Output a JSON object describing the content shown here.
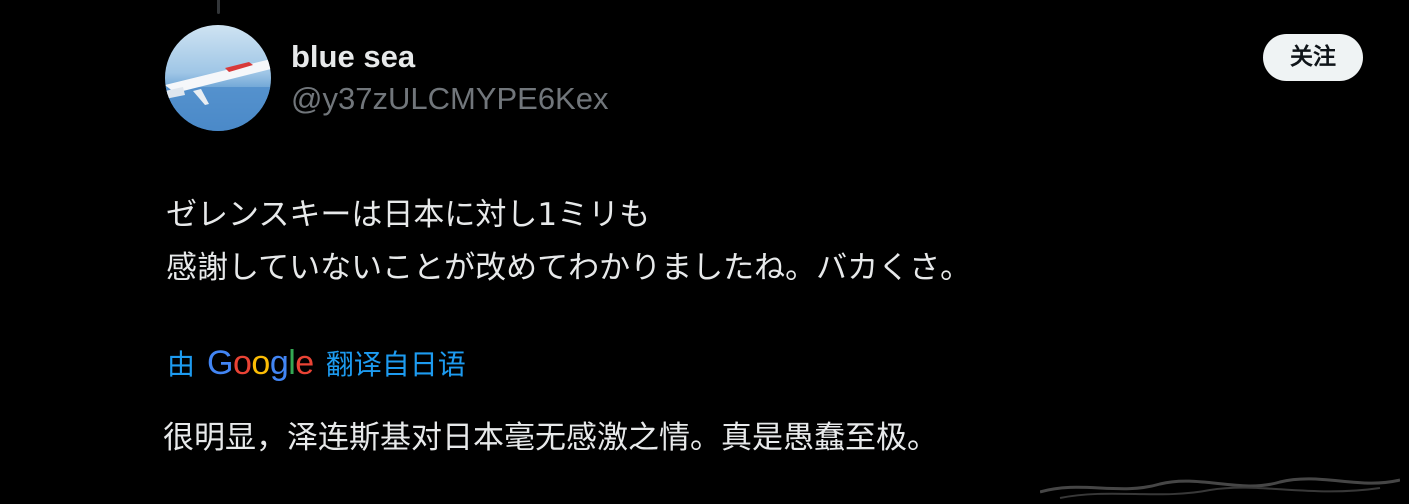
{
  "author": {
    "display_name": "blue sea",
    "handle": "@y37zULCMYPE6Kex",
    "avatar_icon": "airplane-wing-over-sea-avatar"
  },
  "follow_button": {
    "label": "关注"
  },
  "tweet": {
    "lines": [
      "ゼレンスキーは日本に対し1ミリも",
      "感謝していないことが改めてわかりましたね。バカくさ。"
    ]
  },
  "translation": {
    "prefix": "由",
    "provider_letters": [
      "G",
      "o",
      "o",
      "g",
      "l",
      "e"
    ],
    "suffix": "翻译自日语",
    "text": "很明显，泽连斯基对日本毫无感激之情。真是愚蠢至极。"
  },
  "colors": {
    "background": "#000000",
    "text_primary": "#e7e9ea",
    "text_secondary": "#71767b",
    "link_blue": "#1d9bf0",
    "google_blue": "#4285f4",
    "google_red": "#ea4335",
    "google_yellow": "#fbbc05",
    "google_green": "#34a853",
    "button_bg": "#eff3f4"
  }
}
